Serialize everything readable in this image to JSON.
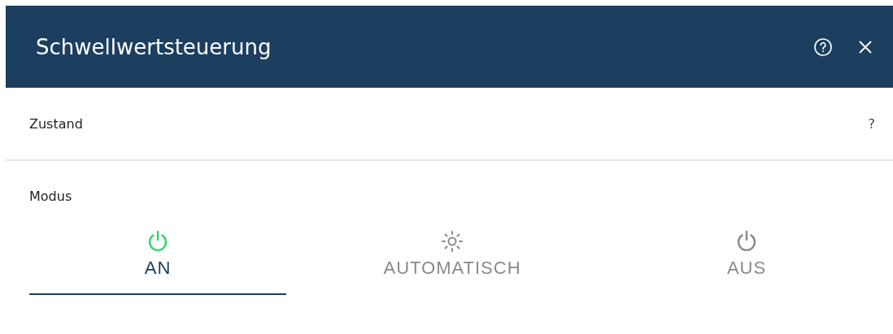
{
  "window": {
    "title": "Schwellwertsteuerung"
  },
  "state_section": {
    "label": "Zustand",
    "hint": "?"
  },
  "mode_section": {
    "label": "Modus"
  },
  "tabs": [
    {
      "label": "AN",
      "kind": "power",
      "selected": true
    },
    {
      "label": "AUTOMATISCH",
      "kind": "auto",
      "selected": false
    },
    {
      "label": "AUS",
      "kind": "power",
      "selected": false
    }
  ]
}
